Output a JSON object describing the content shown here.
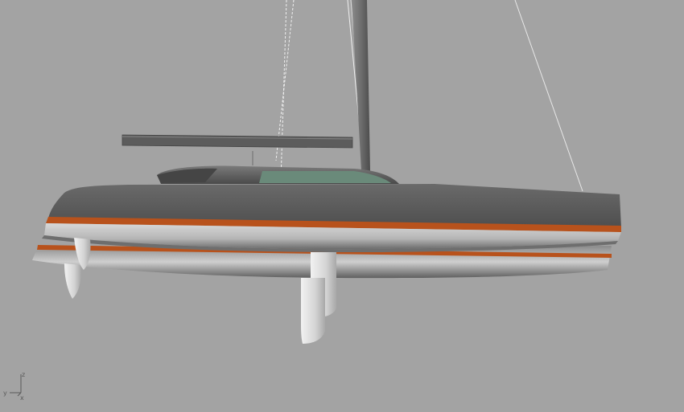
{
  "viewport": {
    "background": "#a3a3a3"
  },
  "model": {
    "hull_color": "#5d5d5d",
    "hull_underside_color": "#c9c9c9",
    "stripe_color": "#b8521c",
    "glass_color": "#6a8a7a",
    "appendage_color": "#e0e0e0"
  },
  "axis_gizmo": {
    "z_label": "z",
    "y_label": "y",
    "x_label": "x"
  }
}
